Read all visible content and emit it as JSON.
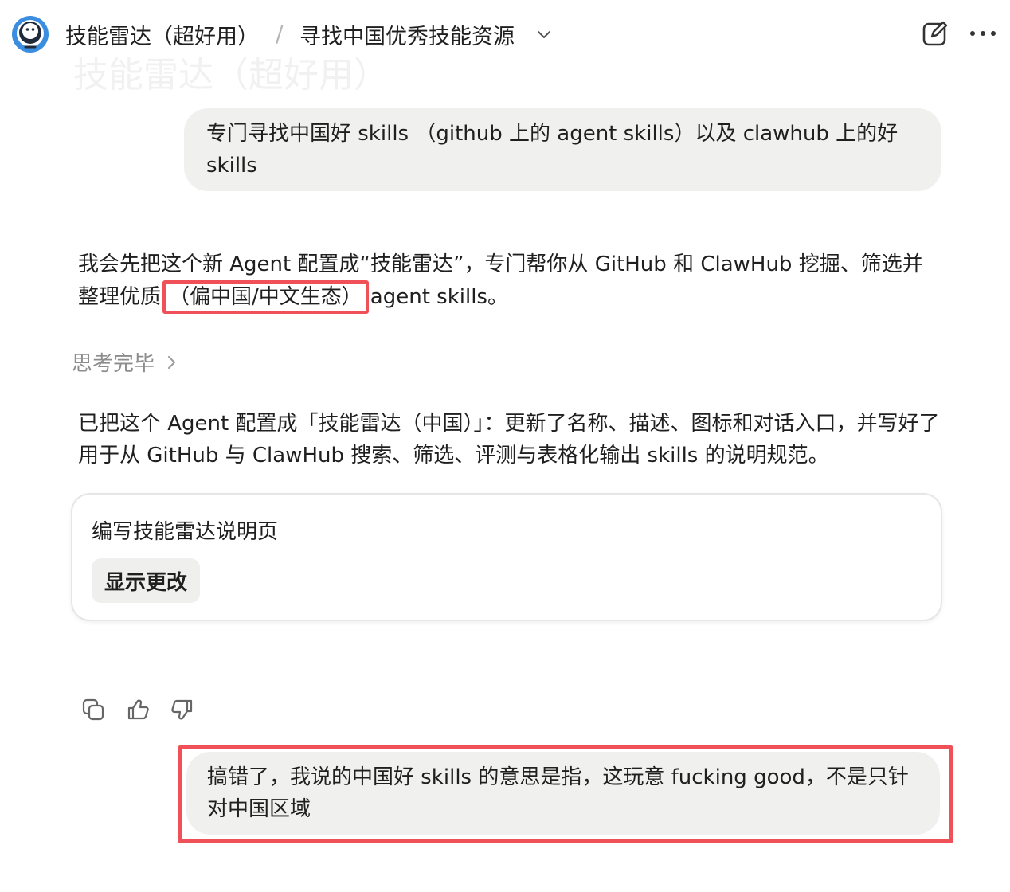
{
  "header": {
    "title": "技能雷达（超好用）",
    "separator": "/",
    "subtitle": "寻找中国优秀技能资源",
    "ghost_title": "技能雷达（超好用）"
  },
  "messages": {
    "user1": "专门寻找中国好 skills （github 上的 agent skills）以及 clawhub 上的好 skills",
    "assistant_intro_before": "我会先把这个新 Agent 配置成“技能雷达”，专门帮你从 GitHub 和 ClawHub 挖掘、筛选并整理优质",
    "assistant_intro_highlight": "（偏中国/中文生态）",
    "assistant_intro_after": "agent skills。",
    "thinking_label": "思考完毕",
    "assistant_result": "已把这个 Agent 配置成「技能雷达（中国）」：更新了名称、描述、图标和对话入口，并写好了用于从 GitHub 与 ClawHub 搜索、筛选、评测与表格化输出 skills 的说明规范。",
    "user2": "搞错了，我说的中国好 skills 的意思是指，这玩意 fucking good，不是只针对中国区域"
  },
  "card": {
    "title": "编写技能雷达说明页",
    "button_label": "显示更改"
  },
  "colors": {
    "highlight": "#f05158",
    "bubble_bg": "#f0f0ee",
    "avatar": "#3b8de0"
  },
  "icons": [
    "avatar-icon",
    "chevron-down-icon",
    "edit-icon",
    "more-icon",
    "chevron-right-icon",
    "copy-icon",
    "thumbs-up-icon",
    "thumbs-down-icon"
  ]
}
